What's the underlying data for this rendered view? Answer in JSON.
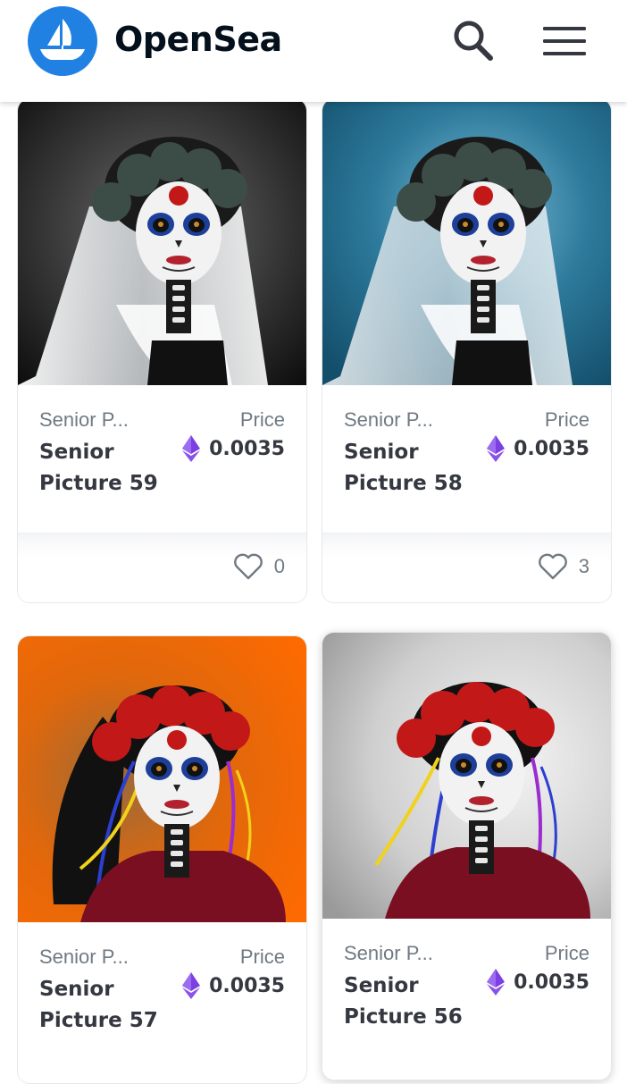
{
  "header": {
    "brand": "OpenSea",
    "logo_icon": "opensea-ship-logo",
    "search_icon": "search-icon",
    "menu_icon": "hamburger-menu-icon"
  },
  "colors": {
    "brand_blue": "#2081e2",
    "text_dark": "#353840",
    "text_muted": "#707a83",
    "eth_purple": "#7b3fe4"
  },
  "cards": [
    {
      "collection": "Senior P...",
      "name": "Senior Picture 59",
      "price_label": "Price",
      "price": "0.0035",
      "likes": "0",
      "background": "black-gradient"
    },
    {
      "collection": "Senior P...",
      "name": "Senior Picture 58",
      "price_label": "Price",
      "price": "0.0035",
      "likes": "3",
      "background": "teal-gradient"
    },
    {
      "collection": "Senior P...",
      "name": "Senior Picture 57",
      "price_label": "Price",
      "price": "0.0035",
      "background": "orange-gradient"
    },
    {
      "collection": "Senior P...",
      "name": "Senior Picture 56",
      "price_label": "Price",
      "price": "0.0035",
      "background": "grey-gradient"
    }
  ]
}
